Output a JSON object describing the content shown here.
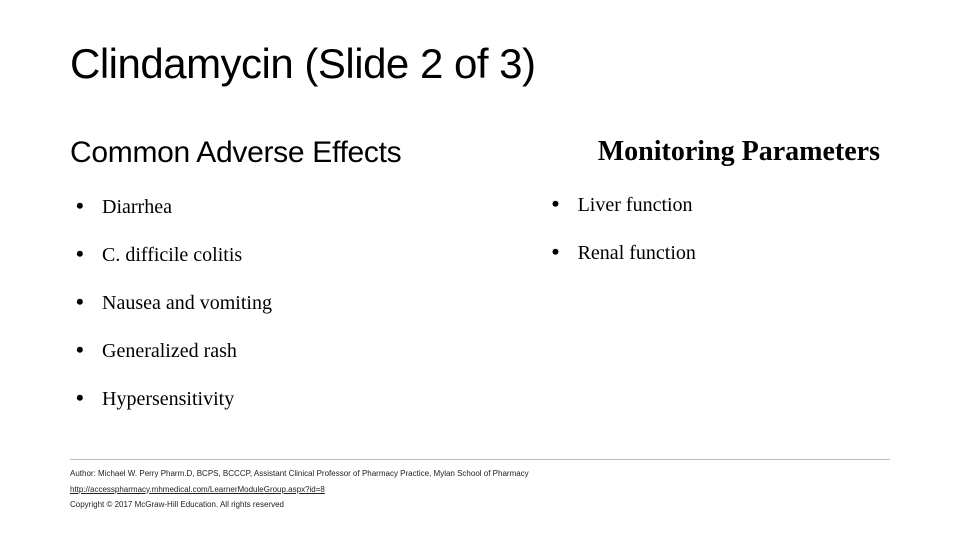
{
  "title": "Clindamycin  (Slide 2 of 3)",
  "left": {
    "heading": "Common Adverse Effects",
    "items": [
      "Diarrhea",
      "C. difficile colitis",
      "Nausea and vomiting",
      "Generalized rash",
      "Hypersensitivity"
    ]
  },
  "right": {
    "heading": "Monitoring Parameters",
    "items": [
      "Liver function",
      "Renal function"
    ]
  },
  "footer": {
    "author": "Author: Michael W. Perry Pharm.D, BCPS, BCCCP, Assistant Clinical Professor of Pharmacy Practice, Mylan School of Pharmacy",
    "link": "http://accesspharmacy.mhmedical.com/LearnerModuleGroup.aspx?id=8",
    "copyright": "Copyright © 2017 McGraw-Hill Education. All rights reserved"
  }
}
